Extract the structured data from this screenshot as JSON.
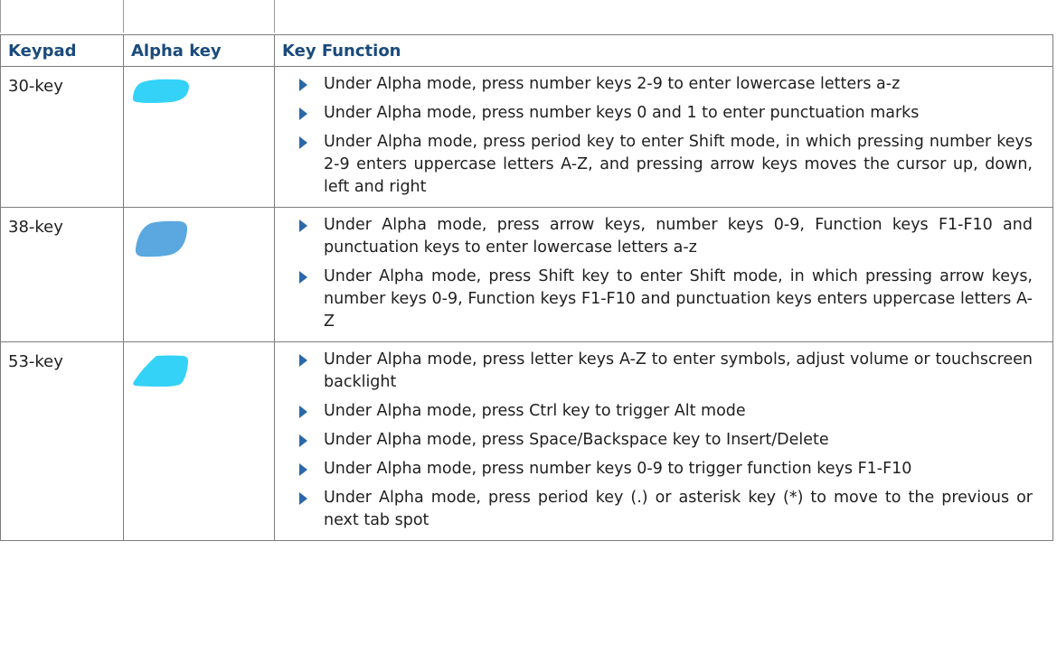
{
  "table": {
    "headers": {
      "keypad": "Keypad",
      "alpha_key": "Alpha key",
      "key_function": "Key Function"
    },
    "rows": [
      {
        "keypad": "30-key",
        "alpha_key_color": "#35d2f8",
        "functions": [
          "Under Alpha mode, press number keys 2-9 to enter lowercase letters a-z",
          "Under Alpha mode, press number keys 0 and 1 to enter punctuation marks",
          "Under Alpha mode, press period key to enter Shift mode, in which pressing number keys 2-9 enters uppercase letters A-Z, and pressing arrow keys moves the cursor up, down, left and right"
        ]
      },
      {
        "keypad": "38-key",
        "alpha_key_color": "#5aa8df",
        "functions": [
          "Under Alpha mode, press arrow keys, number keys 0-9, Function keys F1-F10 and punctuation keys to enter lowercase letters a-z",
          "Under Alpha mode, press Shift key to enter Shift mode, in which pressing arrow keys, number keys 0-9, Function keys F1-F10 and punctuation keys enters uppercase letters A-Z"
        ]
      },
      {
        "keypad": "53-key",
        "alpha_key_color": "#35d2f8",
        "functions": [
          "Under Alpha mode, press letter keys A-Z to enter symbols, adjust volume or touchscreen backlight",
          "Under Alpha mode, press Ctrl key to trigger Alt mode",
          "Under Alpha mode, press Space/Backspace key to Insert/Delete",
          "Under Alpha mode, press number keys 0-9 to trigger function keys F1-F10",
          "Under Alpha mode, press period key (.) or asterisk key (*) to move to the previous or next tab spot"
        ]
      }
    ]
  }
}
